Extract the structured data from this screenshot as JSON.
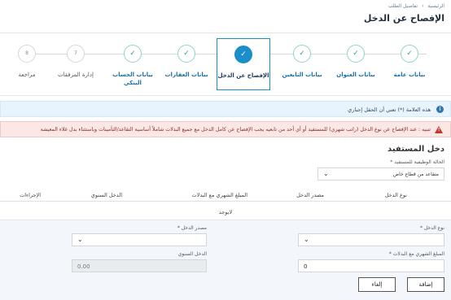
{
  "breadcrumb": {
    "home": "الرئيسية",
    "separator": "›",
    "current": "تفاصيل الطلب"
  },
  "page_title": "الإفصاح عن الدخل",
  "stepper": {
    "steps": [
      {
        "label": "بيانات عامة",
        "state": "done",
        "symbol": "✓"
      },
      {
        "label": "بيانات العنوان",
        "state": "done",
        "symbol": "✓"
      },
      {
        "label": "بيانات التابعين",
        "state": "done",
        "symbol": "✓"
      },
      {
        "label": "الإفصاح عن الدخل",
        "state": "active",
        "symbol": "✓"
      },
      {
        "label": "بيانات العقارات",
        "state": "done",
        "symbol": "✓"
      },
      {
        "label": "بيانات الحساب البنكي",
        "state": "done",
        "symbol": "✓"
      },
      {
        "label": "إدارة المرفقات",
        "state": "pending",
        "symbol": "7"
      },
      {
        "label": "مراجعة",
        "state": "pending",
        "symbol": "8"
      }
    ]
  },
  "info_message": "هذه العلامة (*) تعني أن الحقل إجباري",
  "warning_message": "تنبيه : عند الإفصاح عن نوع الدخل (راتب شهري) للمستفيد أو أي أحد من تابعيه يجب الإفصاح عن كامل الدخل مع جميع البدلات شاملاً أساسية التقاعد/التأمينات وباستثناء بدل غلاء المعيشة",
  "icons": {
    "info": "i",
    "warning": "!",
    "chevron": "⌄"
  },
  "beneficiary_income": {
    "title": "دخل المستفيد",
    "job_status_label": "الحالة الوظيفية للمستفيد *",
    "job_status_value": "متقاعد من قطاع خاص"
  },
  "table": {
    "headers": [
      "نوع الدخل",
      "مصدر الدخل",
      "المبلغ الشهري مع البدلات",
      "الدخل السنوي",
      "الإجراءات"
    ],
    "empty_text": "لايوجد"
  },
  "form": {
    "income_type_label": "نوع الدخل *",
    "income_type_value": "",
    "income_source_label": "مصدر الدخل *",
    "income_source_value": "",
    "monthly_label": "المبلغ الشهري مع البدلات *",
    "monthly_value": "0",
    "annual_label": "الدخل السنوي",
    "annual_value": "0.00",
    "add_button": "إضافة",
    "cancel_button": "إلغاء"
  },
  "colors": {
    "accent": "#1b8ec9",
    "done": "#2aa68d",
    "warning_bg": "#fbe7e6",
    "info_bg": "#e9f3fb"
  }
}
